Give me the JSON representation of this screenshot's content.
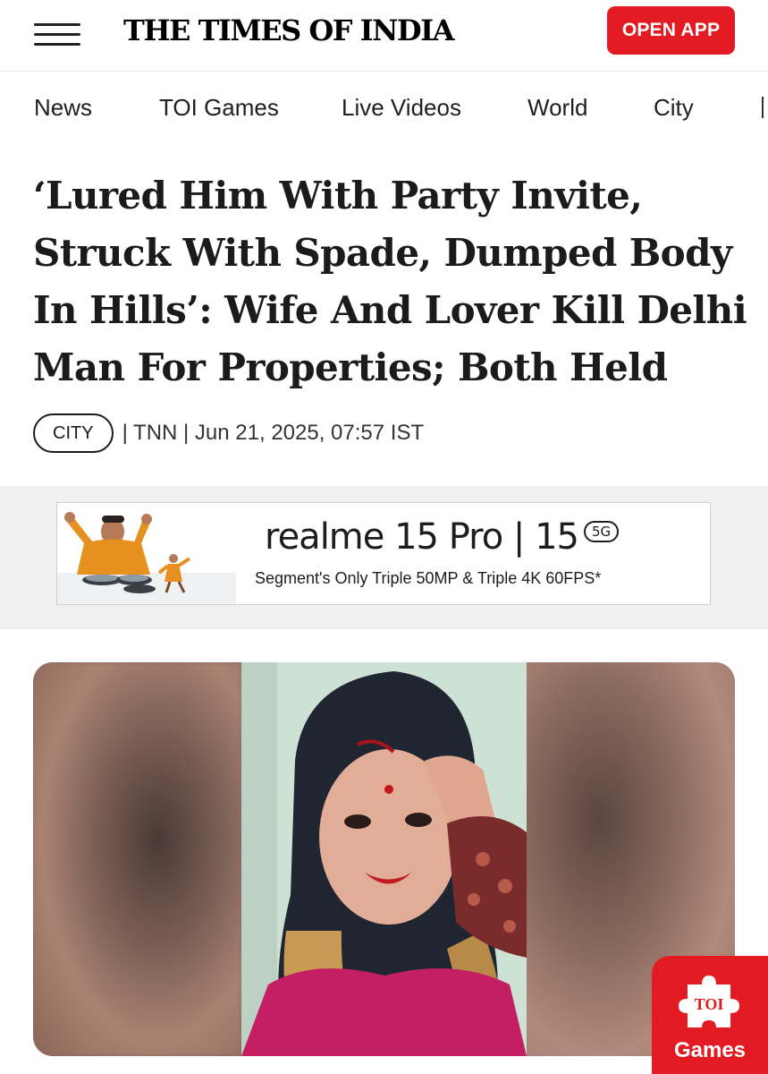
{
  "header": {
    "logo": "THE TIMES OF INDIA",
    "open_app_label": "OPEN APP"
  },
  "nav": {
    "items": [
      "News",
      "TOI Games",
      "Live Videos",
      "World",
      "City"
    ]
  },
  "article": {
    "headline": "‘Lured Him With Party Invite, Struck With Spade, Dumped Body In Hills’: Wife And Lover Kill Delhi Man For Properties; Both Held",
    "category": "CITY",
    "meta": "| TNN | Jun 21, 2025, 07:57 IST"
  },
  "ad": {
    "title": "realme 15 Pro | 15",
    "badge": "5G",
    "subtitle": "Segment's Only Triple 50MP & Triple 4K 60FPS*"
  },
  "toi_games_badge": {
    "logo_text": "TOI",
    "label": "Games"
  },
  "colors": {
    "brand_red": "#e21b22",
    "text": "#1b1b1b",
    "ad_band": "#f1f1f1"
  },
  "icons": [
    "menu-icon",
    "toi-games-puzzle-icon"
  ]
}
